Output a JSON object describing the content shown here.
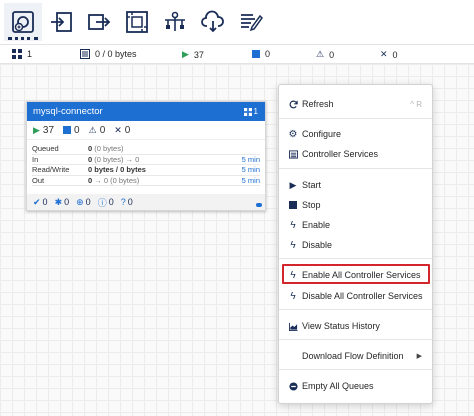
{
  "toolbar": {
    "buttons": [
      {
        "name": "processor-tool",
        "icon": "processor-icon"
      },
      {
        "name": "input-port-tool",
        "icon": "input-port-icon"
      },
      {
        "name": "output-port-tool",
        "icon": "output-port-icon"
      },
      {
        "name": "process-group-tool",
        "icon": "process-group-icon"
      },
      {
        "name": "remote-process-group-tool",
        "icon": "remote-process-group-icon"
      },
      {
        "name": "funnel-tool",
        "icon": "funnel-icon"
      },
      {
        "name": "label-tool",
        "icon": "label-icon"
      }
    ]
  },
  "status": {
    "processors": "1",
    "queued": "0 / 0 bytes",
    "running": "37",
    "stopped": "0",
    "invalid": "0",
    "disabled": "0"
  },
  "processor": {
    "name": "mysql-connector",
    "count_badge": "1",
    "stats": {
      "running": "37",
      "stopped": "0",
      "invalid": "0",
      "disabled": "0"
    },
    "rows": [
      {
        "label": "Queued",
        "value_bold": "0",
        "value_rest": "(0 bytes)",
        "time": ""
      },
      {
        "label": "In",
        "value_bold": "0",
        "value_rest": "(0 bytes) → 0",
        "time": "5 min"
      },
      {
        "label": "Read/Write",
        "value_bold": "0 bytes / 0 bytes",
        "value_rest": "",
        "time": "5 min"
      },
      {
        "label": "Out",
        "value_bold": "0",
        "value_rest": "→ 0 (0 bytes)",
        "time": "5 min"
      }
    ],
    "footer": {
      "up_to_date": "0",
      "locally_modified": "0",
      "stale": "0",
      "errors": "0",
      "sync_failure": "0"
    }
  },
  "menu": {
    "items": [
      {
        "label": "Refresh",
        "shortcut": "^ R"
      },
      {
        "label": "Configure"
      },
      {
        "label": "Controller Services"
      },
      {
        "label": "Start"
      },
      {
        "label": "Stop"
      },
      {
        "label": "Enable"
      },
      {
        "label": "Disable"
      },
      {
        "label": "Enable All Controller Services"
      },
      {
        "label": "Disable All Controller Services"
      },
      {
        "label": "View Status History"
      },
      {
        "label": "Download Flow Definition"
      },
      {
        "label": "Empty All Queues"
      }
    ]
  },
  "colors": {
    "accent": "#1d6fd1",
    "navy": "#1a2d57",
    "running": "#2e9e59",
    "highlight": "#d3262c"
  }
}
